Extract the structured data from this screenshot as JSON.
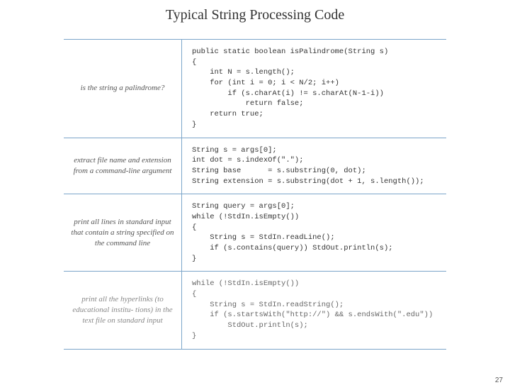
{
  "title": "Typical String Processing Code",
  "rows": [
    {
      "desc": "is the string\na palindrome?",
      "code": "public static boolean isPalindrome(String s)\n{\n    int N = s.length();\n    for (int i = 0; i < N/2; i++)\n        if (s.charAt(i) != s.charAt(N-1-i))\n            return false;\n    return true;\n}"
    },
    {
      "desc": "extract file name\nand extension from a\ncommand-line\nargument",
      "code": "String s = args[0];\nint dot = s.indexOf(\".\");\nString base      = s.substring(0, dot);\nString extension = s.substring(dot + 1, s.length());"
    },
    {
      "desc": "print all lines in\nstandard input that\ncontain a string\nspecified on the\ncommand line",
      "code": "String query = args[0];\nwhile (!StdIn.isEmpty())\n{\n    String s = StdIn.readLine();\n    if (s.contains(query)) StdOut.println(s);\n}"
    },
    {
      "desc": "print all the hyperlinks\n(to educational institu-\ntions) in the text file on\nstandard input",
      "code": "while (!StdIn.isEmpty())\n{\n    String s = StdIn.readString();\n    if (s.startsWith(\"http://\") && s.endsWith(\".edu\"))\n        StdOut.println(s);\n}"
    }
  ],
  "page_number": "27"
}
